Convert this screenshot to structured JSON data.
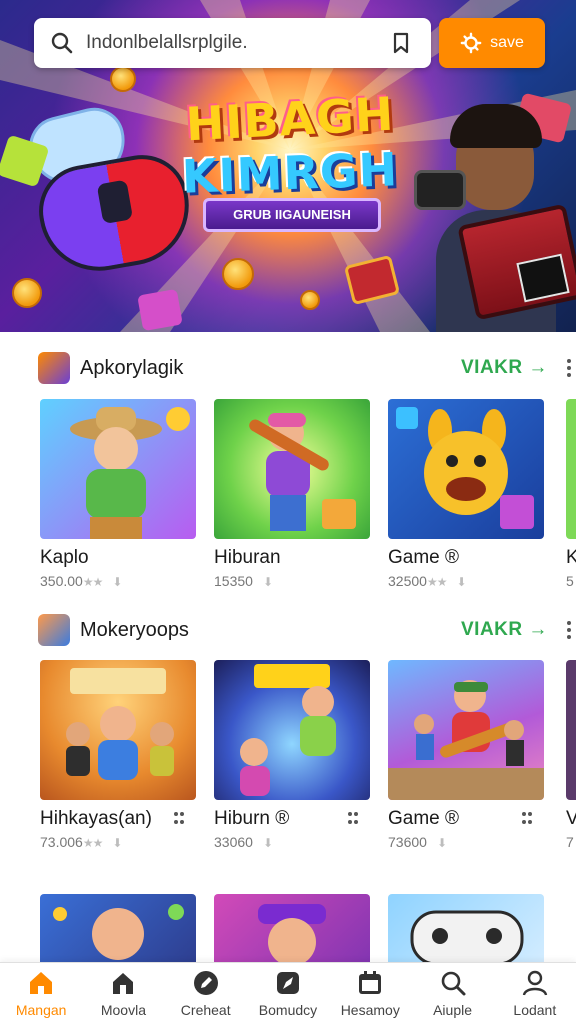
{
  "search": {
    "placeholder": "Indonlbelallsrplgile.",
    "save_label": "save"
  },
  "hero": {
    "title_line1": "HIBAGH",
    "title_line2": "KIMRGH",
    "ribbon": "GRUB IIGAUNEISH"
  },
  "sections": [
    {
      "title": "Apkorylagik",
      "more_label": "VIAKR →",
      "cards": [
        {
          "title": "Kaplo",
          "meta": "350.00"
        },
        {
          "title": "Hiburan",
          "meta": "15350"
        },
        {
          "title": "Game ®",
          "meta": "32500"
        },
        {
          "title": "K",
          "meta": "5"
        }
      ]
    },
    {
      "title": "Mokeryoops",
      "more_label": "VIAKR →",
      "cards": [
        {
          "title": "Hihkayas(an)",
          "meta": "73.006"
        },
        {
          "title": "Hiburn ®",
          "meta": "33060"
        },
        {
          "title": "Game ®",
          "meta": "73600"
        },
        {
          "title": "V",
          "meta": "7"
        }
      ]
    }
  ],
  "third_row": {
    "cards": [
      {
        "thumb": "game-character-thumbnail"
      },
      {
        "thumb": "game-character-thumbnail"
      },
      {
        "thumb": "game-controller-thumbnail"
      }
    ]
  },
  "bottom_nav": [
    {
      "label": "Mangan",
      "icon": "home-icon",
      "active": true
    },
    {
      "label": "Moovla",
      "icon": "house-icon",
      "active": false
    },
    {
      "label": "Creheat",
      "icon": "pencil-icon",
      "active": false
    },
    {
      "label": "Bomudcy",
      "icon": "rocket-icon",
      "active": false
    },
    {
      "label": "Hesamoy",
      "icon": "calendar-icon",
      "active": false
    },
    {
      "label": "Aiuple",
      "icon": "search-icon",
      "active": false
    },
    {
      "label": "Lodant",
      "icon": "profile-icon",
      "active": false
    }
  ],
  "colors": {
    "accent": "#ff8a00",
    "more_link": "#2fa84f"
  }
}
